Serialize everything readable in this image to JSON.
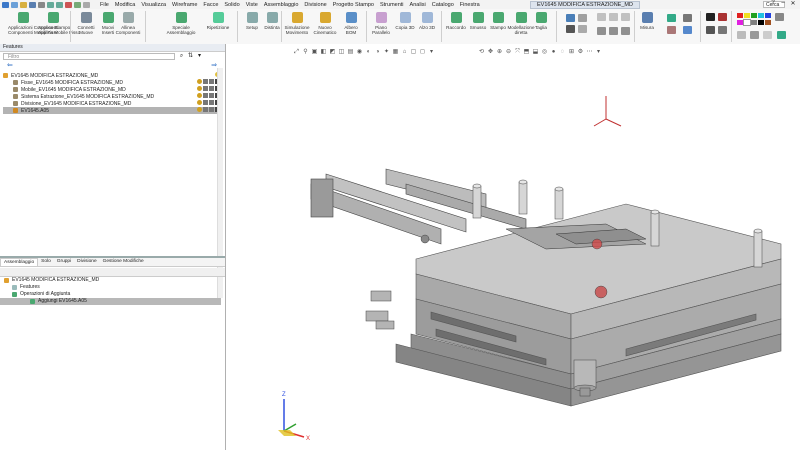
{
  "menu": [
    "File",
    "Modifica",
    "Visualizza",
    "Wireframe",
    "Facce",
    "Solido",
    "Viste",
    "Assemblaggio",
    "Divisione",
    "Progetto Stampo",
    "Strumenti",
    "Analisi",
    "Catalogo",
    "Finestra"
  ],
  "doc_title": "EV1645 MODIFICA ESTRAZIONE_MD",
  "search_placeholder": "Cerca",
  "ribbon": [
    {
      "label": "Applicazioni Componenti",
      "sub": "Componenti Mobili Fissi"
    },
    {
      "label": "Applica Stampo",
      "sub": "Applica Mobile Fisso"
    },
    {
      "label": "Connetti",
      "sub": "Muove"
    },
    {
      "label": "Muovi",
      "sub": "Inserti"
    },
    {
      "label": "Allinea",
      "sub": "Componenti"
    },
    {
      "label": "Speciale",
      "sub": "Assemblaggio"
    },
    {
      "label": "Ripetizione",
      "sub": ""
    },
    {
      "label": "Setup",
      "sub": ""
    },
    {
      "label": "Distinta",
      "sub": ""
    },
    {
      "label": "Simulazione",
      "sub": "Movimento"
    },
    {
      "label": "Nuovo",
      "sub": "Cinematico"
    },
    {
      "label": "Albero",
      "sub": "BOM"
    },
    {
      "label": "Piano",
      "sub": "Parallelo"
    },
    {
      "label": "Copia 3D",
      "sub": ""
    },
    {
      "label": "Alzo 3D",
      "sub": ""
    },
    {
      "label": "Raccordo",
      "sub": ""
    },
    {
      "label": "Smusso",
      "sub": ""
    },
    {
      "label": "Stampo",
      "sub": ""
    },
    {
      "label": "Modellazione",
      "sub": "diretta"
    },
    {
      "label": "Taglia",
      "sub": ""
    },
    {
      "label": "Misura",
      "sub": ""
    }
  ],
  "left_panel": {
    "header": "Features",
    "filter_placeholder": "Filtro",
    "tree": [
      {
        "label": "EV1645 MODIFICA ESTRAZIONE_MD",
        "level": 0,
        "color": "#e0a030"
      },
      {
        "label": "Fisse_EV1645 MODIFICA ESTRAZIONE_MD",
        "level": 1,
        "color": "#9a8a6a"
      },
      {
        "label": "Mobile_EV1645 MODIFICA ESTRAZIONE_MD",
        "level": 1,
        "color": "#9a8a6a"
      },
      {
        "label": "Sistema Estrazione_EV1645 MODIFICA ESTRAZIONE_MD",
        "level": 1,
        "color": "#9a8a6a"
      },
      {
        "label": "Divisione_EV1645 MODIFICA ESTRAZIONE_MD",
        "level": 1,
        "color": "#9a8a6a"
      },
      {
        "label": "EV1645.A05",
        "level": 1,
        "color": "#d08820",
        "selected": true
      }
    ],
    "tabs": [
      "Assemblaggio",
      "Solo",
      "Gruppi",
      "Divisione",
      "Gestione Modifiche"
    ],
    "lower_tree": [
      {
        "label": "EV1645 MODIFICA ESTRAZIONE_MD",
        "level": 0
      },
      {
        "label": "Features",
        "level": 1
      },
      {
        "label": "Operazioni di Aggiunta",
        "level": 1
      },
      {
        "label": "Aggiungi EV1645.A05",
        "level": 2,
        "selected": true
      }
    ]
  },
  "colors": {
    "accent": "#3c78c8",
    "selection": "#b3b3b3",
    "triad_x": "#e03030",
    "triad_y": "#30a030",
    "triad_z": "#3050e0"
  }
}
